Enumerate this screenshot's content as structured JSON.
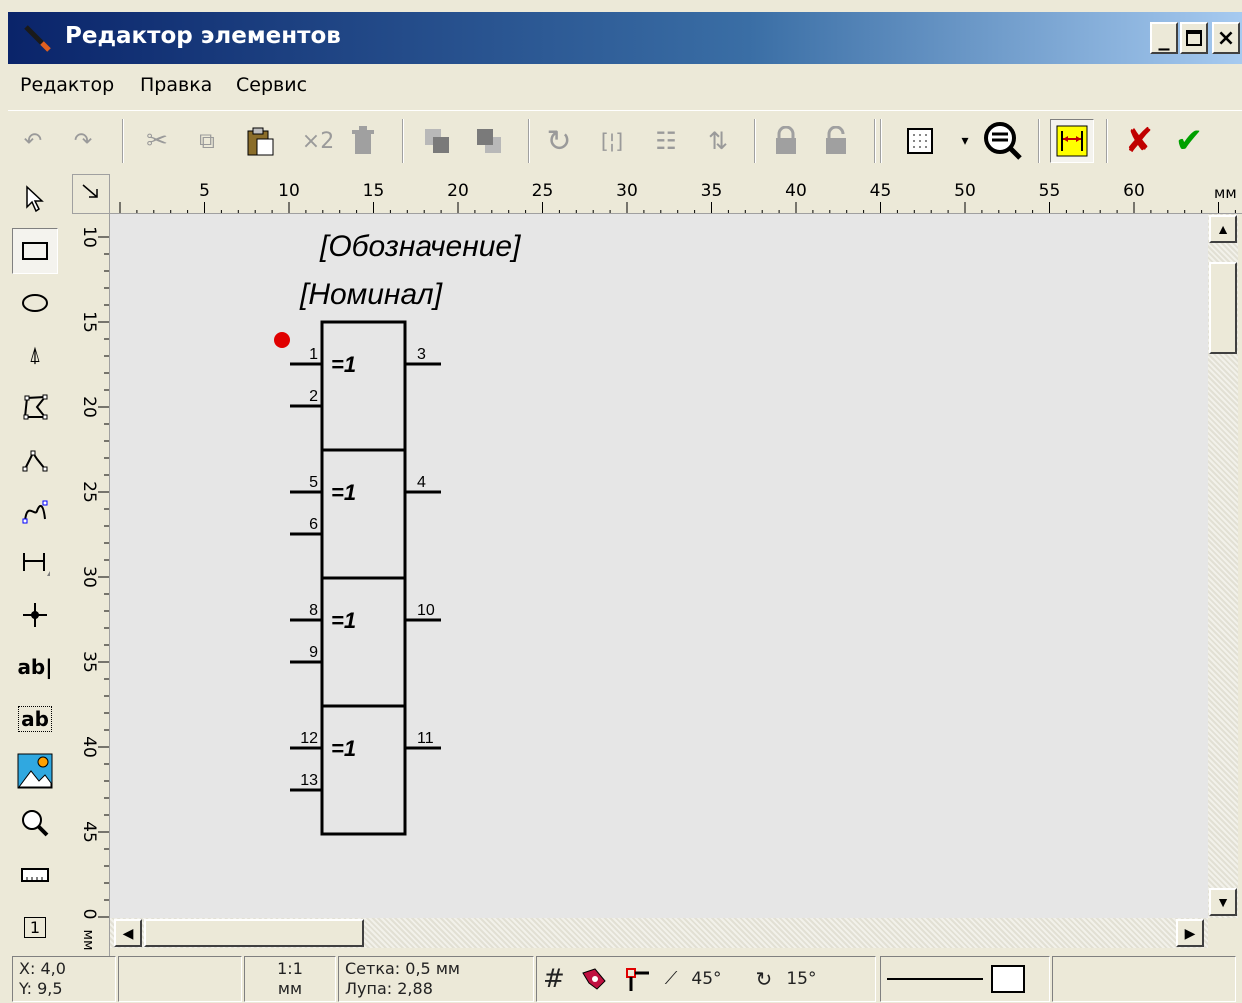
{
  "window": {
    "title": "Редактор элементов",
    "buttons": [
      "_",
      "□",
      "×"
    ]
  },
  "menu": [
    "Редактор",
    "Правка",
    "Сервис"
  ],
  "toolbar": {
    "duplicate_label": "×2",
    "icons": [
      "undo-icon",
      "redo-icon",
      "cut-icon",
      "copy-icon",
      "paste-icon",
      "duplicate-icon",
      "delete-icon",
      "bring-front-icon",
      "send-back-icon",
      "rotate-icon",
      "mirror-horizontal-icon",
      "mirror-vertical-icon",
      "flip-icon",
      "lock-icon",
      "unlock-icon",
      "grid-select-icon",
      "zoom-fit-icon",
      "dimension-toggle-icon",
      "cancel-icon",
      "accept-icon"
    ]
  },
  "left_tools": [
    "pointer",
    "rectangle",
    "ellipse",
    "arc",
    "polygon",
    "polyline",
    "curve",
    "dimension",
    "pin",
    "text",
    "text-frame",
    "image",
    "zoom",
    "ruler",
    "number"
  ],
  "left_text": {
    "text_tool": "ab|",
    "text_frame_tool": "ab",
    "number_tool": "1"
  },
  "ruler": {
    "unit": "мм",
    "h_labels": [
      "5",
      "10",
      "15",
      "20",
      "25",
      "30",
      "35",
      "40",
      "45",
      "50",
      "55",
      "60"
    ],
    "v_labels": [
      "10",
      "15",
      "20",
      "25",
      "30",
      "35",
      "40",
      "45",
      "0"
    ],
    "v_unit": "мм"
  },
  "element": {
    "designation": "[Обозначение]",
    "nominal": "[Номинал]",
    "gates": [
      {
        "label": "=1",
        "in1": "1",
        "in2": "2",
        "out": "3"
      },
      {
        "label": "=1",
        "in1": "5",
        "in2": "6",
        "out": "4"
      },
      {
        "label": "=1",
        "in1": "8",
        "in2": "9",
        "out": "10"
      },
      {
        "label": "=1",
        "in1": "12",
        "in2": "13",
        "out": "11"
      }
    ]
  },
  "status": {
    "x": "X: 4,0",
    "y": "Y: 9,5",
    "scale": "1:1",
    "scale_unit": "мм",
    "grid": "Сетка: 0,5 мм",
    "zoom": "Лупа:  2,88",
    "angle1": "45°",
    "angle2": "15°"
  },
  "colors": {
    "title_start": "#0a246a",
    "title_end": "#a6caf0",
    "marker": "#e00000",
    "accept": "#00a000",
    "cancel": "#c00000"
  }
}
